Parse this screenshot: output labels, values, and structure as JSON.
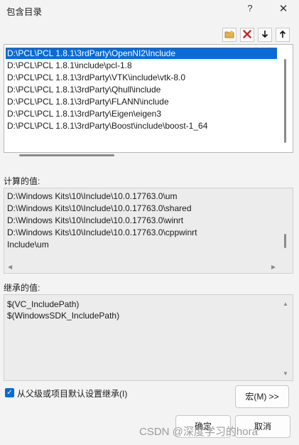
{
  "window": {
    "title": "包含目录",
    "help": "?",
    "close": "✕"
  },
  "toolbar": {
    "new_folder_icon": "folder-icon",
    "delete_icon": "delete-icon",
    "down_icon": "arrow-down-icon",
    "up_icon": "arrow-up-icon"
  },
  "directories": [
    "D:\\PCL\\PCL 1.8.1\\3rdParty\\OpenNI2\\Include",
    "D:\\PCL\\PCL 1.8.1\\include\\pcl-1.8",
    "D:\\PCL\\PCL 1.8.1\\3rdParty\\VTK\\include\\vtk-8.0",
    "D:\\PCL\\PCL 1.8.1\\3rdParty\\Qhull\\include",
    "D:\\PCL\\PCL 1.8.1\\3rdParty\\FLANN\\include",
    "D:\\PCL\\PCL 1.8.1\\3rdParty\\Eigen\\eigen3",
    "D:\\PCL\\PCL 1.8.1\\3rdParty\\Boost\\include\\boost-1_64"
  ],
  "evaluated": {
    "label": "计算的值:",
    "lines": [
      "D:\\Windows Kits\\10\\Include\\10.0.17763.0\\um",
      "D:\\Windows Kits\\10\\Include\\10.0.17763.0\\shared",
      "D:\\Windows Kits\\10\\Include\\10.0.17763.0\\winrt",
      "D:\\Windows Kits\\10\\Include\\10.0.17763.0\\cppwinrt",
      "Include\\um"
    ]
  },
  "inherited": {
    "label": "继承的值:",
    "lines": [
      "$(VC_IncludePath)",
      "$(WindowsSDK_IncludePath)"
    ]
  },
  "inherit_checkbox": {
    "label": "从父级或项目默认设置继承(I)",
    "checked": true
  },
  "buttons": {
    "macros": "宏(M) >>",
    "ok": "确定",
    "cancel": "取消"
  },
  "watermark": "CSDN @深度学习的hora"
}
